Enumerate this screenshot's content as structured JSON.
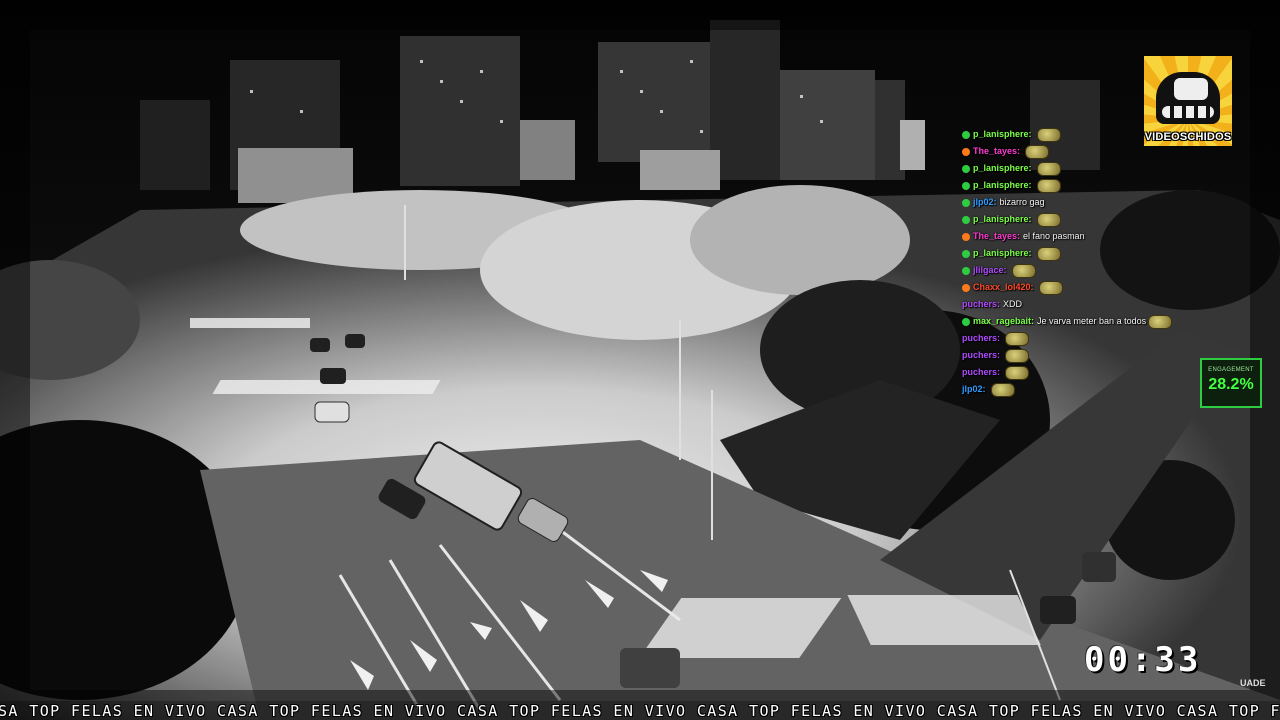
{
  "logo": {
    "text": "VIDEOSCHIDOS",
    "icon": "truck-wheel-logo-icon"
  },
  "chat": {
    "messages": [
      {
        "user": "p_lanisphere",
        "message": "",
        "color": "#7cff4a",
        "badge": "#2ecc40",
        "emote": true
      },
      {
        "user": "The_tayes",
        "message": "",
        "color": "#ff3ad1",
        "badge": "#ff7a1a",
        "emote": true
      },
      {
        "user": "p_lanisphere",
        "message": "",
        "color": "#7cff4a",
        "badge": "#2ecc40",
        "emote": true
      },
      {
        "user": "p_lanisphere",
        "message": "",
        "color": "#7cff4a",
        "badge": "#2ecc40",
        "emote": true
      },
      {
        "user": "jlp02",
        "message": "bizarro gag",
        "color": "#2f9bff",
        "badge": "#2ecc40",
        "emote": false
      },
      {
        "user": "p_lanisphere",
        "message": "",
        "color": "#7cff4a",
        "badge": "#2ecc40",
        "emote": true
      },
      {
        "user": "The_tayes",
        "message": "el fano pasman",
        "color": "#ff3ad1",
        "badge": "#ff7a1a",
        "emote": false
      },
      {
        "user": "p_lanisphere",
        "message": "",
        "color": "#7cff4a",
        "badge": "#2ecc40",
        "emote": true
      },
      {
        "user": "jlilgace",
        "message": "",
        "color": "#b04cff",
        "badge": "#2ecc40",
        "emote": true
      },
      {
        "user": "Chaxx_lol420",
        "message": "",
        "color": "#ff4a2a",
        "badge": "#ff7a1a",
        "emote": true
      },
      {
        "user": "puchers",
        "message": "XDD",
        "color": "#b04cff",
        "badge": null,
        "emote": false
      },
      {
        "user": "max_ragebait",
        "message": "Je varva meter ban a todos",
        "color": "#7cff4a",
        "badge": "#2ecc40",
        "emote": true
      },
      {
        "user": "puchers",
        "message": "",
        "color": "#b04cff",
        "badge": null,
        "emote": true
      },
      {
        "user": "puchers",
        "message": "",
        "color": "#b04cff",
        "badge": null,
        "emote": true
      },
      {
        "user": "puchers",
        "message": "",
        "color": "#b04cff",
        "badge": null,
        "emote": true
      },
      {
        "user": "jlp02",
        "message": "",
        "color": "#2f9bff",
        "badge": null,
        "emote": true
      }
    ]
  },
  "engagement": {
    "label": "ENGAGEMENT",
    "value": "28.2%"
  },
  "timer": "00:33",
  "watermark": "UADE",
  "ticker": {
    "text": "SA TOP FELAS EN VIVO CASA TOP FELAS EN VIVO CASA TOP FELAS EN VIVO CASA TOP FELAS EN VIVO CASA TOP FELAS EN VIVO CASA TOP FELAS EN VIVO CASA TOP FELAS"
  }
}
